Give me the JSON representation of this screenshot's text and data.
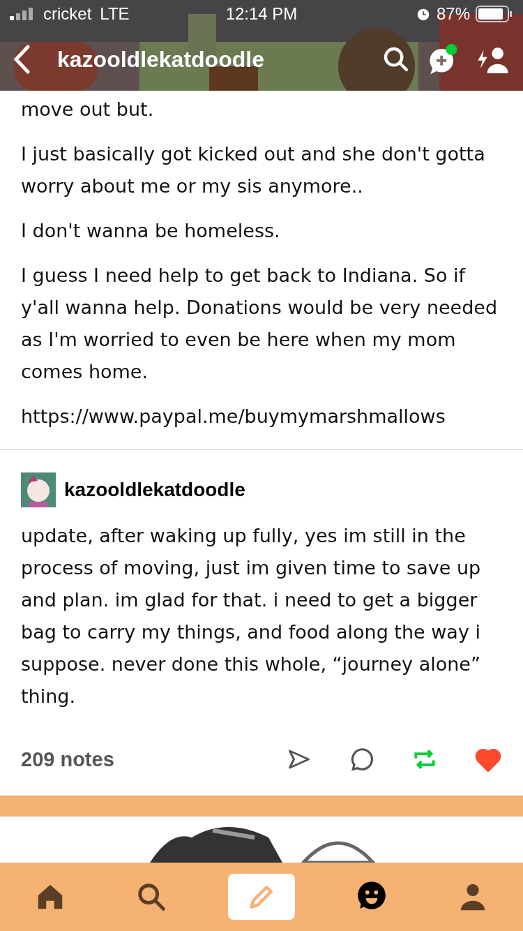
{
  "status_bar": {
    "carrier": "cricket",
    "network": "LTE",
    "time": "12:14 PM",
    "battery": "87%"
  },
  "header": {
    "title": "kazooldlekatdoodle",
    "messages_badge": true
  },
  "post": {
    "paragraphs": [
      "move out but.",
      "I just basically got kicked out and she don't gotta worry about me or my sis anymore..",
      "I don't wanna be homeless.",
      "I guess I need help to get back to Indiana. So if y'all wanna help. Donations would be very needed as I'm worried to even be here when my mom comes home.",
      "https://www.paypal.me/buymymarshmallows"
    ],
    "reblog": {
      "author": "kazooldlekatdoodle",
      "text": "update, after waking up fully, yes im still in the process of moving, just im given time to save up and plan. im glad for that. i need to get a bigger bag to carry my things, and food along the way i suppose. never done this whole, “journey alone” thing."
    },
    "notes": "209 notes",
    "reblogged": true,
    "liked": true
  },
  "tab_bar": [
    {
      "kind": "home",
      "unread": false
    },
    {
      "kind": "search",
      "unread": false
    },
    {
      "kind": "compose",
      "unread": false
    },
    {
      "kind": "activity",
      "unread": true
    },
    {
      "kind": "account",
      "unread": false
    }
  ]
}
